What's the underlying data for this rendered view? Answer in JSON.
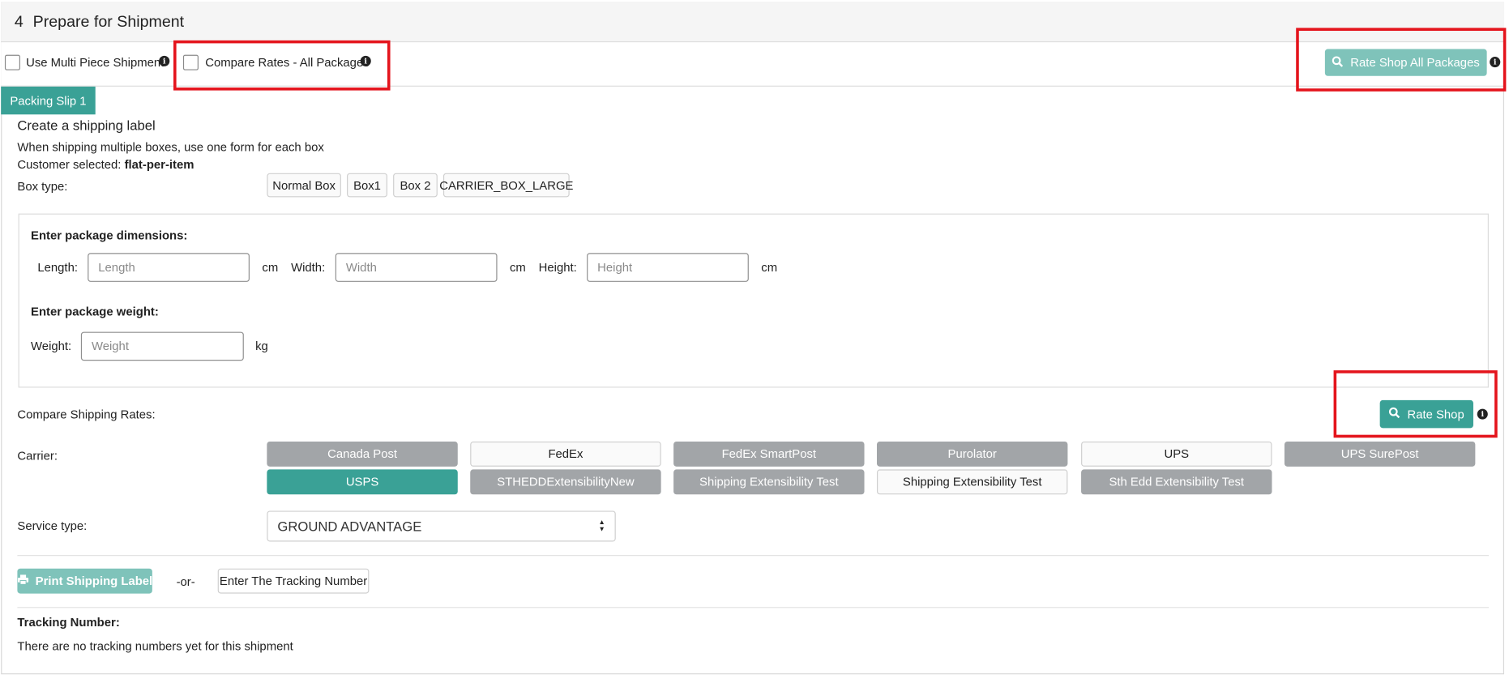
{
  "header": {
    "step_number": "4",
    "title": "Prepare for Shipment"
  },
  "options": {
    "multi_piece_label": "Use Multi Piece Shipment",
    "compare_rates_label": "Compare Rates - All Packages",
    "rate_shop_all_label": "Rate Shop All Packages"
  },
  "packing_slip": {
    "tab_label": "Packing Slip 1",
    "heading": "Create a shipping label",
    "hint": "When shipping multiple boxes, use one form for each box",
    "customer_selected_prefix": "Customer selected:",
    "customer_selected_value": "flat-per-item",
    "box_type_label": "Box type:",
    "box_types": [
      "Normal Box",
      "Box1",
      "Box 2",
      "CARRIER_BOX_LARGE"
    ]
  },
  "dimensions": {
    "heading": "Enter package dimensions:",
    "length_label": "Length:",
    "length_placeholder": "Length",
    "width_label": "Width:",
    "width_placeholder": "Width",
    "height_label": "Height:",
    "height_placeholder": "Height",
    "unit": "cm",
    "weight_heading": "Enter package weight:",
    "weight_label": "Weight:",
    "weight_placeholder": "Weight",
    "weight_unit": "kg"
  },
  "rates": {
    "compare_label": "Compare Shipping Rates:",
    "rate_shop_label": "Rate Shop",
    "carrier_label": "Carrier:",
    "carriers_row1": [
      "Canada Post",
      "FedEx",
      "FedEx SmartPost",
      "Purolator",
      "UPS",
      "UPS SurePost"
    ],
    "carriers_row2": [
      "USPS",
      "STHEDDExtensibilityNew",
      "Shipping Extensibility Test",
      "Shipping Extensibility Test",
      "Sth Edd Extensibility Test"
    ],
    "selected_carrier": "USPS",
    "service_type_label": "Service type:",
    "service_type_value": "GROUND ADVANTAGE"
  },
  "actions": {
    "print_label": "Print Shipping Label",
    "or_text": "-or-",
    "enter_tracking": "Enter The Tracking Number"
  },
  "tracking": {
    "heading": "Tracking Number:",
    "empty_text": "There are no tracking numbers yet for this shipment"
  },
  "colors": {
    "teal": "#3aa196",
    "teal_light": "#7fc3ba",
    "gray_button": "#a2a5a8",
    "highlight": "#e4141c"
  }
}
